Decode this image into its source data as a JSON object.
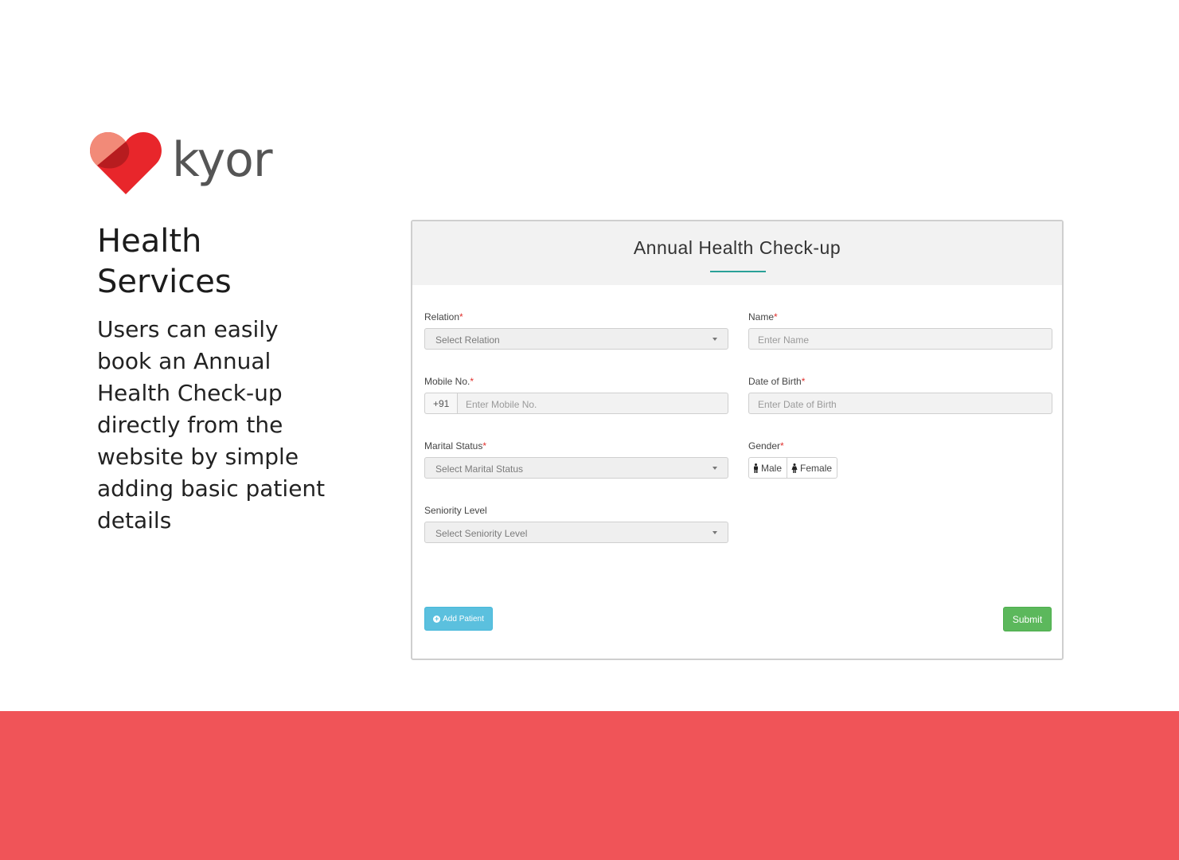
{
  "brand": {
    "name": "kyor"
  },
  "hero": {
    "title": "Health Services",
    "description": "Users can easily book an Annual Health Check-up directly from the website by simple adding basic patient details"
  },
  "form": {
    "title": "Annual Health Check-up",
    "required_marker": "*",
    "relation": {
      "label": "Relation",
      "value": "Select Relation"
    },
    "name": {
      "label": "Name",
      "placeholder": "Enter Name"
    },
    "mobile": {
      "label": "Mobile No.",
      "prefix": "+91",
      "placeholder": "Enter Mobile No."
    },
    "dob": {
      "label": "Date of Birth",
      "placeholder": "Enter Date of Birth"
    },
    "marital": {
      "label": "Marital Status",
      "value": "Select Marital Status"
    },
    "gender": {
      "label": "Gender",
      "options": [
        "Male",
        "Female"
      ]
    },
    "seniority": {
      "label": "Seniority Level",
      "value": "Select Seniority Level"
    },
    "add_patient_label": "Add Patient",
    "submit_label": "Submit"
  },
  "colors": {
    "accent_band": "#f05458",
    "teal_underline": "#2aa198",
    "info_button": "#5bc0de",
    "success_button": "#5cb85c",
    "required": "#e0302c"
  }
}
